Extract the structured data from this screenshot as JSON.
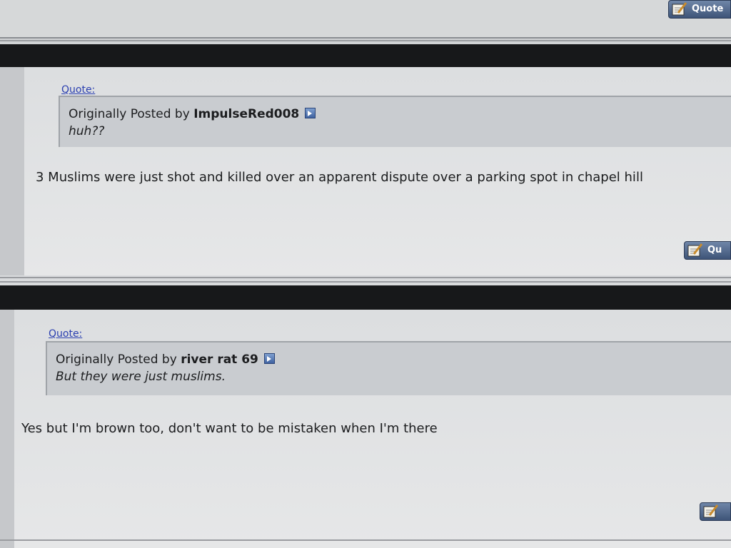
{
  "posts": [
    {
      "quote_link": "Quote:",
      "quote_prefix": "Originally Posted by",
      "quote_author": "ImpulseRed008",
      "quoted_text": "huh??",
      "body": "3 Muslims were just shot and killed over an apparent dispute over a parking spot in chapel hill",
      "button_label": "Qu"
    },
    {
      "quote_link": "Quote:",
      "quote_prefix": "Originally Posted by",
      "quote_author": "river rat 69",
      "quoted_text": "But they were just muslims.",
      "body": "Yes but I'm brown too, don't want to be mistaken when I'm there",
      "button_label": ""
    }
  ],
  "top_button_label": "Quote",
  "colors": {
    "link": "#2a3fb0",
    "bar": "#17181a",
    "button": "#3e5478"
  },
  "icons": [
    "pencil-quote-icon",
    "view-post-icon"
  ]
}
